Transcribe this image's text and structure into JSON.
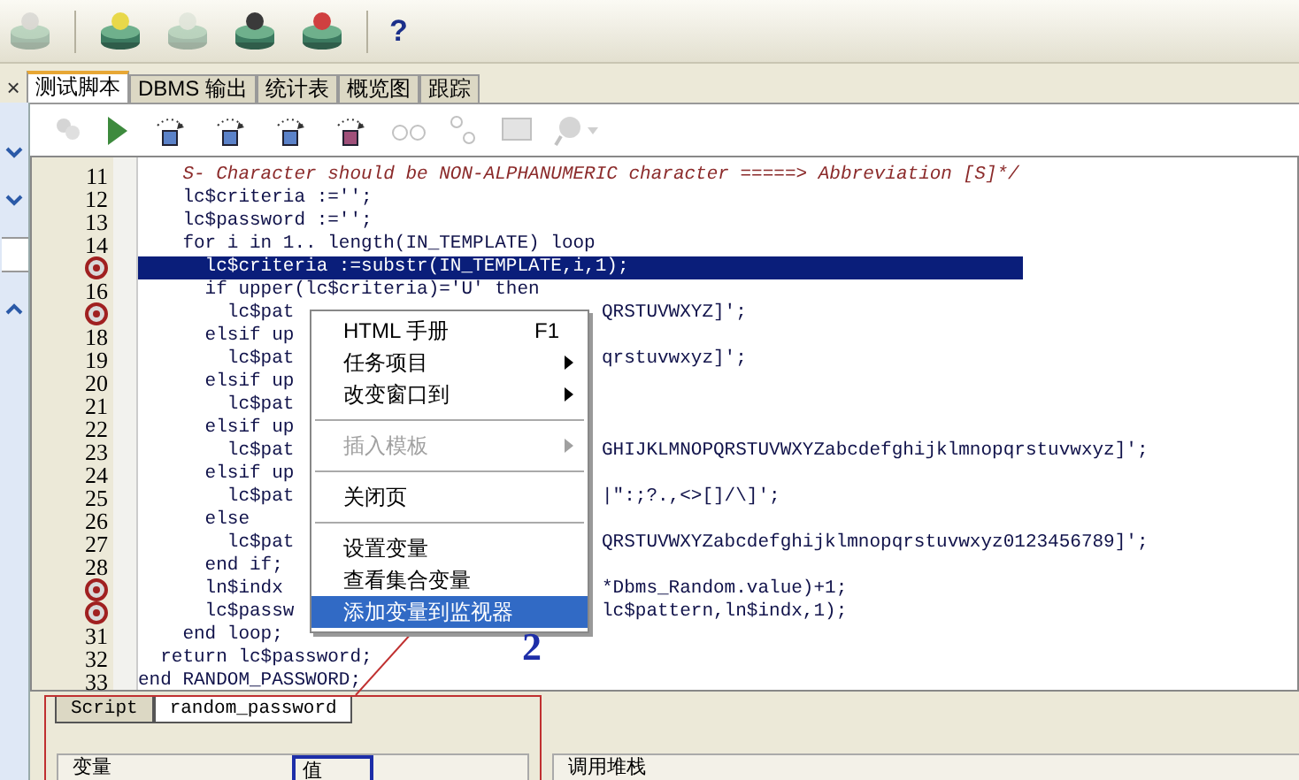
{
  "main_toolbar": {
    "help_label": "?"
  },
  "tabs": [
    {
      "kind": "close",
      "label": "×"
    },
    {
      "kind": "tab",
      "label": "测试脚本",
      "selected": true
    },
    {
      "kind": "tab",
      "label": "DBMS 输出",
      "selected": false
    },
    {
      "kind": "tab",
      "label": "统计表",
      "selected": false
    },
    {
      "kind": "tab",
      "label": "概览图",
      "selected": false
    },
    {
      "kind": "tab",
      "label": "跟踪",
      "selected": false
    }
  ],
  "editor": {
    "lines": [
      {
        "number": "11",
        "text": "    S- Character should be NON-ALPHANUMERIC character =====> Abbreviation [S]*/",
        "kind": "comment",
        "breakpoint": false,
        "selected": false
      },
      {
        "number": "12",
        "text": "    lc$criteria :='';",
        "kind": "code",
        "breakpoint": false,
        "selected": false
      },
      {
        "number": "13",
        "text": "    lc$password :='';",
        "kind": "code",
        "breakpoint": false,
        "selected": false
      },
      {
        "number": "14",
        "text": "    for i in 1.. length(IN_TEMPLATE) loop",
        "kind": "code",
        "breakpoint": false,
        "selected": false
      },
      {
        "text": "      lc$criteria :=substr(IN_TEMPLATE,i,1);",
        "kind": "code",
        "breakpoint": true,
        "selected": true
      },
      {
        "number": "16",
        "text": "      if upper(lc$criteria)='U' then",
        "kind": "code",
        "breakpoint": false,
        "selected": false
      },
      {
        "text": "        lc$pat",
        "tail": "QRSTUVWXYZ]';",
        "kind": "code",
        "breakpoint": true,
        "selected": false
      },
      {
        "number": "18",
        "text": "      elsif up",
        "kind": "code",
        "breakpoint": false,
        "selected": false
      },
      {
        "number": "19",
        "text": "        lc$pat",
        "tail": "qrstuvwxyz]';",
        "kind": "code",
        "breakpoint": false,
        "selected": false
      },
      {
        "number": "20",
        "text": "      elsif up",
        "kind": "code",
        "breakpoint": false,
        "selected": false
      },
      {
        "number": "21",
        "text": "        lc$pat",
        "kind": "code",
        "breakpoint": false,
        "selected": false
      },
      {
        "number": "22",
        "text": "      elsif up",
        "kind": "code",
        "breakpoint": false,
        "selected": false
      },
      {
        "number": "23",
        "text": "        lc$pat",
        "tail": "GHIJKLMNOPQRSTUVWXYZabcdefghijklmnopqrstuvwxyz]';",
        "kind": "code",
        "breakpoint": false,
        "selected": false
      },
      {
        "number": "24",
        "text": "      elsif up",
        "kind": "code",
        "breakpoint": false,
        "selected": false
      },
      {
        "number": "25",
        "text": "        lc$pat",
        "tail": "|\":;?.,<>[]/\\]';",
        "kind": "code",
        "breakpoint": false,
        "selected": false
      },
      {
        "number": "26",
        "text": "      else",
        "kind": "code",
        "breakpoint": false,
        "selected": false
      },
      {
        "number": "27",
        "text": "        lc$pat",
        "tail": "QRSTUVWXYZabcdefghijklmnopqrstuvwxyz0123456789]';",
        "kind": "code",
        "breakpoint": false,
        "selected": false
      },
      {
        "number": "28",
        "text": "      end if;",
        "kind": "code",
        "breakpoint": false,
        "selected": false
      },
      {
        "text": "      ln$indx",
        "tail": "*Dbms_Random.value)+1;",
        "kind": "code",
        "breakpoint": true,
        "selected": false
      },
      {
        "text": "      lc$passw",
        "tail": "lc$pattern,ln$indx,1);",
        "kind": "code",
        "breakpoint": true,
        "selected": false
      },
      {
        "number": "31",
        "text": "    end loop;",
        "kind": "code",
        "breakpoint": false,
        "selected": false
      },
      {
        "number": "32",
        "text": "  return lc$password;",
        "kind": "code",
        "breakpoint": false,
        "selected": false
      },
      {
        "number": "33",
        "text": "end RANDOM_PASSWORD;",
        "kind": "code",
        "breakpoint": false,
        "selected": false
      }
    ]
  },
  "context_menu": {
    "items": [
      {
        "kind": "item",
        "label": "HTML 手册",
        "shortcut": "F1",
        "submenu": false,
        "disabled": false,
        "selected": false
      },
      {
        "kind": "item",
        "label": "任务项目",
        "submenu": true,
        "disabled": false,
        "selected": false
      },
      {
        "kind": "item",
        "label": "改变窗口到",
        "submenu": true,
        "disabled": false,
        "selected": false
      },
      {
        "kind": "separator"
      },
      {
        "kind": "item",
        "label": "插入模板",
        "submenu": true,
        "disabled": true,
        "selected": false
      },
      {
        "kind": "separator"
      },
      {
        "kind": "item",
        "label": "关闭页",
        "submenu": false,
        "disabled": false,
        "selected": false
      },
      {
        "kind": "separator"
      },
      {
        "kind": "item",
        "label": "设置变量",
        "submenu": false,
        "disabled": false,
        "selected": false
      },
      {
        "kind": "item",
        "label": "查看集合变量",
        "submenu": false,
        "disabled": false,
        "selected": false
      },
      {
        "kind": "item",
        "label": "添加变量到监视器",
        "submenu": false,
        "disabled": false,
        "selected": true
      }
    ]
  },
  "annotation": {
    "number": "2"
  },
  "bottom_tabs": [
    {
      "label": "Script",
      "selected": false
    },
    {
      "label": "random_password",
      "selected": true
    }
  ],
  "variables_table": {
    "columns": [
      "变量",
      "值"
    ]
  },
  "call_stack": {
    "title": "调用堆栈"
  }
}
